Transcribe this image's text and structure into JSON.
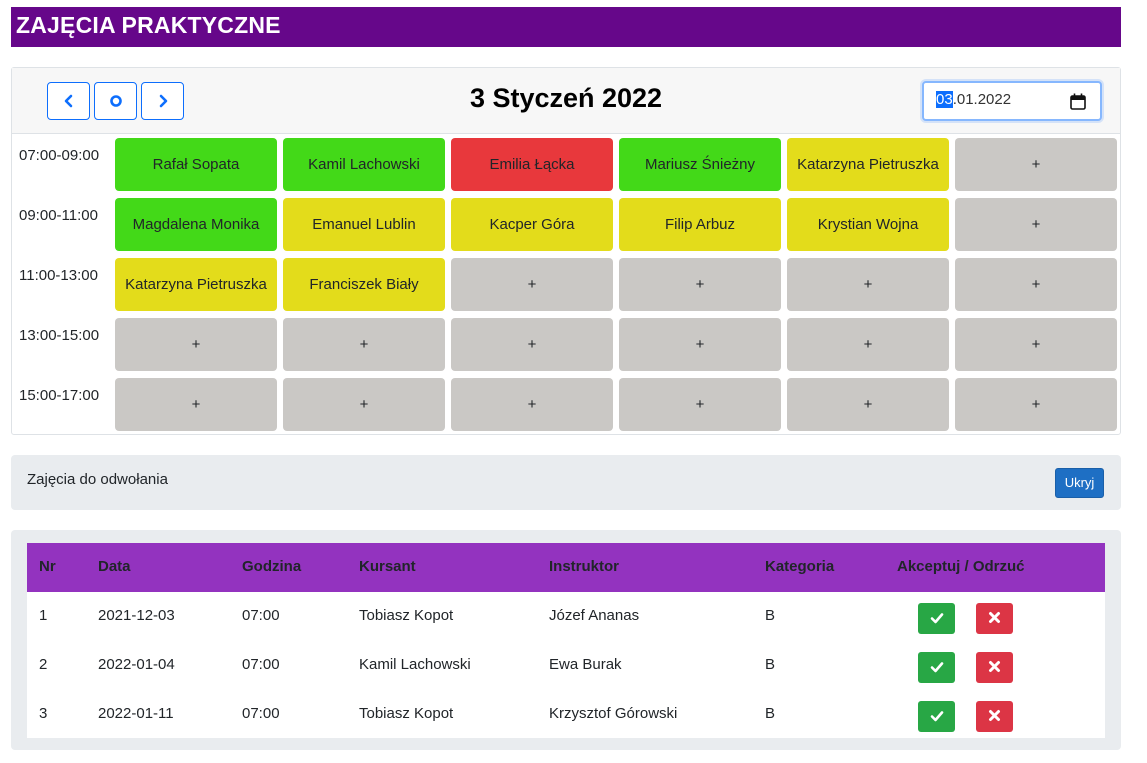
{
  "header": {
    "title": "ZAJĘCIA PRAKTYCZNE"
  },
  "calendar": {
    "title": "3 Styczeń 2022",
    "date_input": {
      "day": "03",
      "rest": ".01.2022"
    },
    "nav": {
      "prev_icon": "chevron-left-icon",
      "today_icon": "circle-icon",
      "next_icon": "chevron-right-icon"
    },
    "colors": {
      "green": "#43d918",
      "yellow": "#e3dc1b",
      "red": "#e8383c",
      "empty": "#cac8c5"
    },
    "time_slots": [
      "07:00-09:00",
      "09:00-11:00",
      "11:00-13:00",
      "13:00-15:00",
      "15:00-17:00"
    ],
    "rows": [
      [
        {
          "label": "Rafał Sopata",
          "status": "green"
        },
        {
          "label": "Kamil Lachowski",
          "status": "green"
        },
        {
          "label": "Emilia Łącka",
          "status": "red"
        },
        {
          "label": "Mariusz Śnieżny",
          "status": "green"
        },
        {
          "label": "Katarzyna Pietruszka",
          "status": "yellow"
        },
        {
          "label": "+",
          "status": "empty"
        }
      ],
      [
        {
          "label": "Magdalena Monika",
          "status": "green"
        },
        {
          "label": "Emanuel Lublin",
          "status": "yellow"
        },
        {
          "label": "Kacper Góra",
          "status": "yellow"
        },
        {
          "label": "Filip Arbuz",
          "status": "yellow"
        },
        {
          "label": "Krystian Wojna",
          "status": "yellow"
        },
        {
          "label": "+",
          "status": "empty"
        }
      ],
      [
        {
          "label": "Katarzyna Pietruszka",
          "status": "yellow"
        },
        {
          "label": "Franciszek Biały",
          "status": "yellow"
        },
        {
          "label": "+",
          "status": "empty"
        },
        {
          "label": "+",
          "status": "empty"
        },
        {
          "label": "+",
          "status": "empty"
        },
        {
          "label": "+",
          "status": "empty"
        }
      ],
      [
        {
          "label": "+",
          "status": "empty"
        },
        {
          "label": "+",
          "status": "empty"
        },
        {
          "label": "+",
          "status": "empty"
        },
        {
          "label": "+",
          "status": "empty"
        },
        {
          "label": "+",
          "status": "empty"
        },
        {
          "label": "+",
          "status": "empty"
        }
      ],
      [
        {
          "label": "+",
          "status": "empty"
        },
        {
          "label": "+",
          "status": "empty"
        },
        {
          "label": "+",
          "status": "empty"
        },
        {
          "label": "+",
          "status": "empty"
        },
        {
          "label": "+",
          "status": "empty"
        },
        {
          "label": "+",
          "status": "empty"
        }
      ]
    ]
  },
  "cancellations": {
    "label": "Zajęcia do odwołania",
    "hide_button": "Ukryj",
    "headers": [
      "Nr",
      "Data",
      "Godzina",
      "Kursant",
      "Instruktor",
      "Kategoria",
      "Akceptuj / Odrzuć"
    ],
    "rows": [
      {
        "nr": "1",
        "data": "2021-12-03",
        "godzina": "07:00",
        "kursant": "Tobiasz Kopot",
        "instruktor": "Józef Ananas",
        "kategoria": "B"
      },
      {
        "nr": "2",
        "data": "2022-01-04",
        "godzina": "07:00",
        "kursant": "Kamil Lachowski",
        "instruktor": "Ewa Burak",
        "kategoria": "B"
      },
      {
        "nr": "3",
        "data": "2022-01-11",
        "godzina": "07:00",
        "kursant": "Tobiasz Kopot",
        "instruktor": "Krzysztof Górowski",
        "kategoria": "B"
      }
    ],
    "accept_icon": "check-icon",
    "reject_icon": "x-icon"
  }
}
